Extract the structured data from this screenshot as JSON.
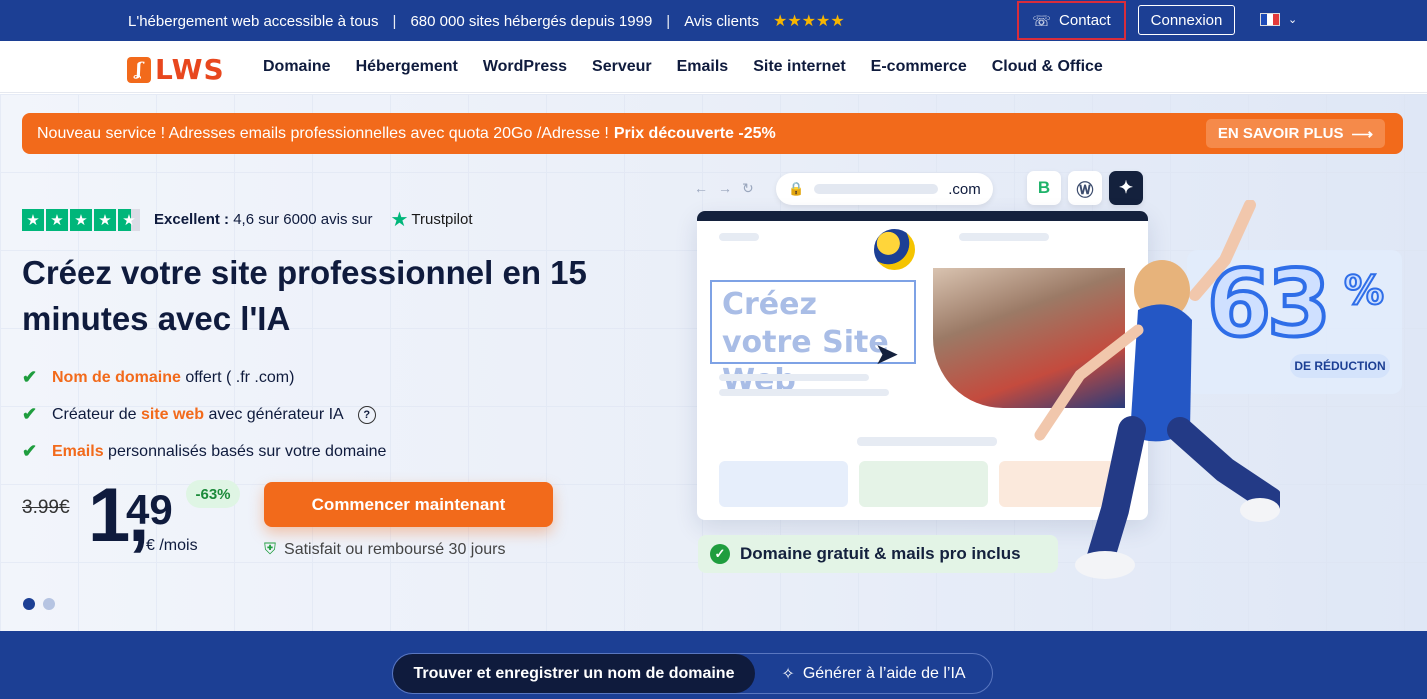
{
  "topbar": {
    "tagline": "L'hébergement web accessible à tous",
    "sites": "680 000 sites hébergés depuis 1999",
    "reviews_label": "Avis clients",
    "reviews_stars": "★★★★★",
    "contact_label": "Contact",
    "login_label": "Connexion"
  },
  "nav": {
    "logo_text": "LWS",
    "items": [
      "Domaine",
      "Hébergement",
      "WordPress",
      "Serveur",
      "Emails",
      "Site internet",
      "E-commerce",
      "Cloud & Office"
    ]
  },
  "promo": {
    "text": "Nouveau service ! Adresses emails professionnelles avec quota 20Go /Adresse !",
    "highlight": "Prix découverte -25%",
    "more_label": "EN SAVOIR PLUS"
  },
  "trustpilot": {
    "stars": "★",
    "rating_label": "Excellent :",
    "rating_text": "4,6 sur 6000 avis sur",
    "brand": "Trustpilot"
  },
  "hero": {
    "headline": "Créez votre site professionnel en 15 minutes avec l'IA",
    "features": [
      {
        "highlight": "Nom de domaine",
        "text": " offert ( .fr .com)"
      },
      {
        "prefix": "Créateur de ",
        "highlight": "site web",
        "text": " avec générateur IA"
      },
      {
        "highlight": "Emails",
        "text": " personnalisés basés sur votre domaine"
      }
    ],
    "old_price": "3.99€",
    "price_int": "1,",
    "price_dec": "49",
    "price_unit": "€ /mois",
    "discount": "-63%",
    "cta_label": "Commencer maintenant",
    "guarantee": "Satisfait ou remboursé 30 jours",
    "slide_count": 2,
    "active_slide": 1
  },
  "illustration": {
    "url_suffix": ".com",
    "site_title": "Créez votre Site Web",
    "big_percent": "63",
    "percent_sign": "%",
    "reduction_label": "DE RÉDUCTION",
    "domain_pill": "Domaine gratuit & mails pro inclus"
  },
  "band": {
    "tab_domain": "Trouver et enregistrer un nom de domaine",
    "tab_ai": "Générer à l’aide de l’IA"
  },
  "colors": {
    "brand_blue": "#1c3f94",
    "brand_orange": "#f26a1b",
    "trust_green": "#00b67a"
  }
}
